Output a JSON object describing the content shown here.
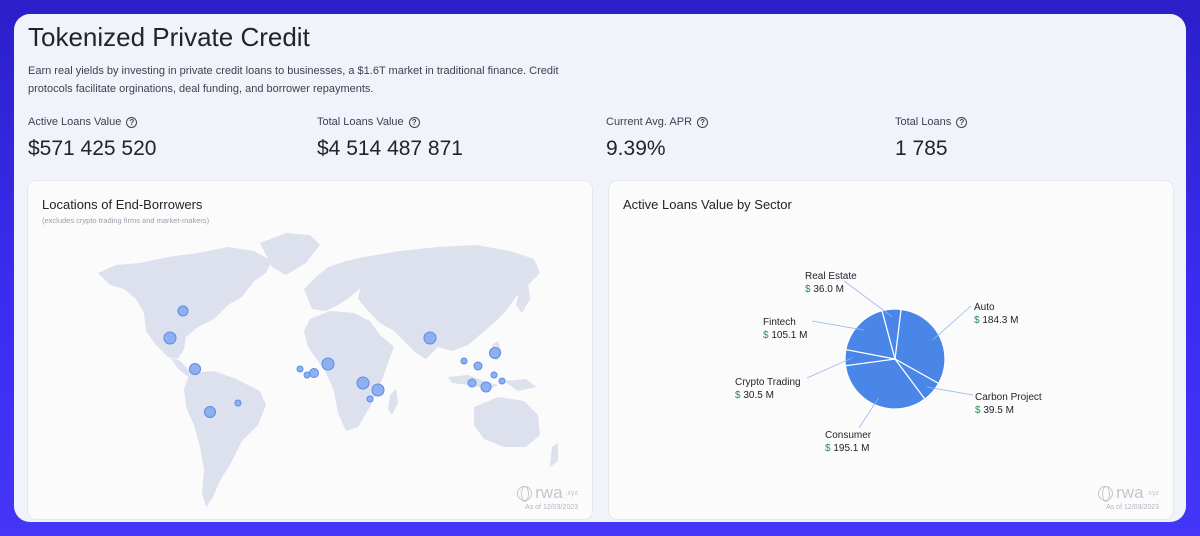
{
  "header": {
    "title": "Tokenized Private Credit",
    "description": "Earn real yields by investing in private credit loans to businesses, a $1.6T market in traditional finance. Credit protocols facilitate orginations, deal funding, and borrower repayments."
  },
  "stats": [
    {
      "label": "Active Loans Value",
      "value": "$571 425 520"
    },
    {
      "label": "Total Loans Value",
      "value": "$4 514 487 871"
    },
    {
      "label": "Current Avg. APR",
      "value": "9.39%"
    },
    {
      "label": "Total Loans",
      "value": "1 785"
    }
  ],
  "map_card": {
    "title": "Locations of End-Borrowers",
    "subtitle": "(excludes crypto trading firms and market-makers)"
  },
  "sector_card": {
    "title": "Active Loans Value by Sector"
  },
  "watermark": {
    "brand": "rwa",
    "tld": ".xyz",
    "date": "As of 12/03/2023"
  },
  "colors": {
    "accent": "#4a86e8",
    "map_land": "#dde1ee",
    "panel": "#f1f3fa",
    "dollar": "#2e8b57"
  },
  "chart_data": {
    "type": "pie",
    "title": "Active Loans Value by Sector",
    "unit": "M",
    "slices": [
      {
        "name": "Auto",
        "value": 184.3,
        "display": "184.3 M"
      },
      {
        "name": "Carbon Project",
        "value": 39.5,
        "display": "39.5 M"
      },
      {
        "name": "Consumer",
        "value": 195.1,
        "display": "195.1 M"
      },
      {
        "name": "Crypto Trading",
        "value": 30.5,
        "display": "30.5 M"
      },
      {
        "name": "Fintech",
        "value": 105.1,
        "display": "105.1 M"
      },
      {
        "name": "Real Estate",
        "value": 36.0,
        "display": "36.0 M"
      }
    ]
  }
}
